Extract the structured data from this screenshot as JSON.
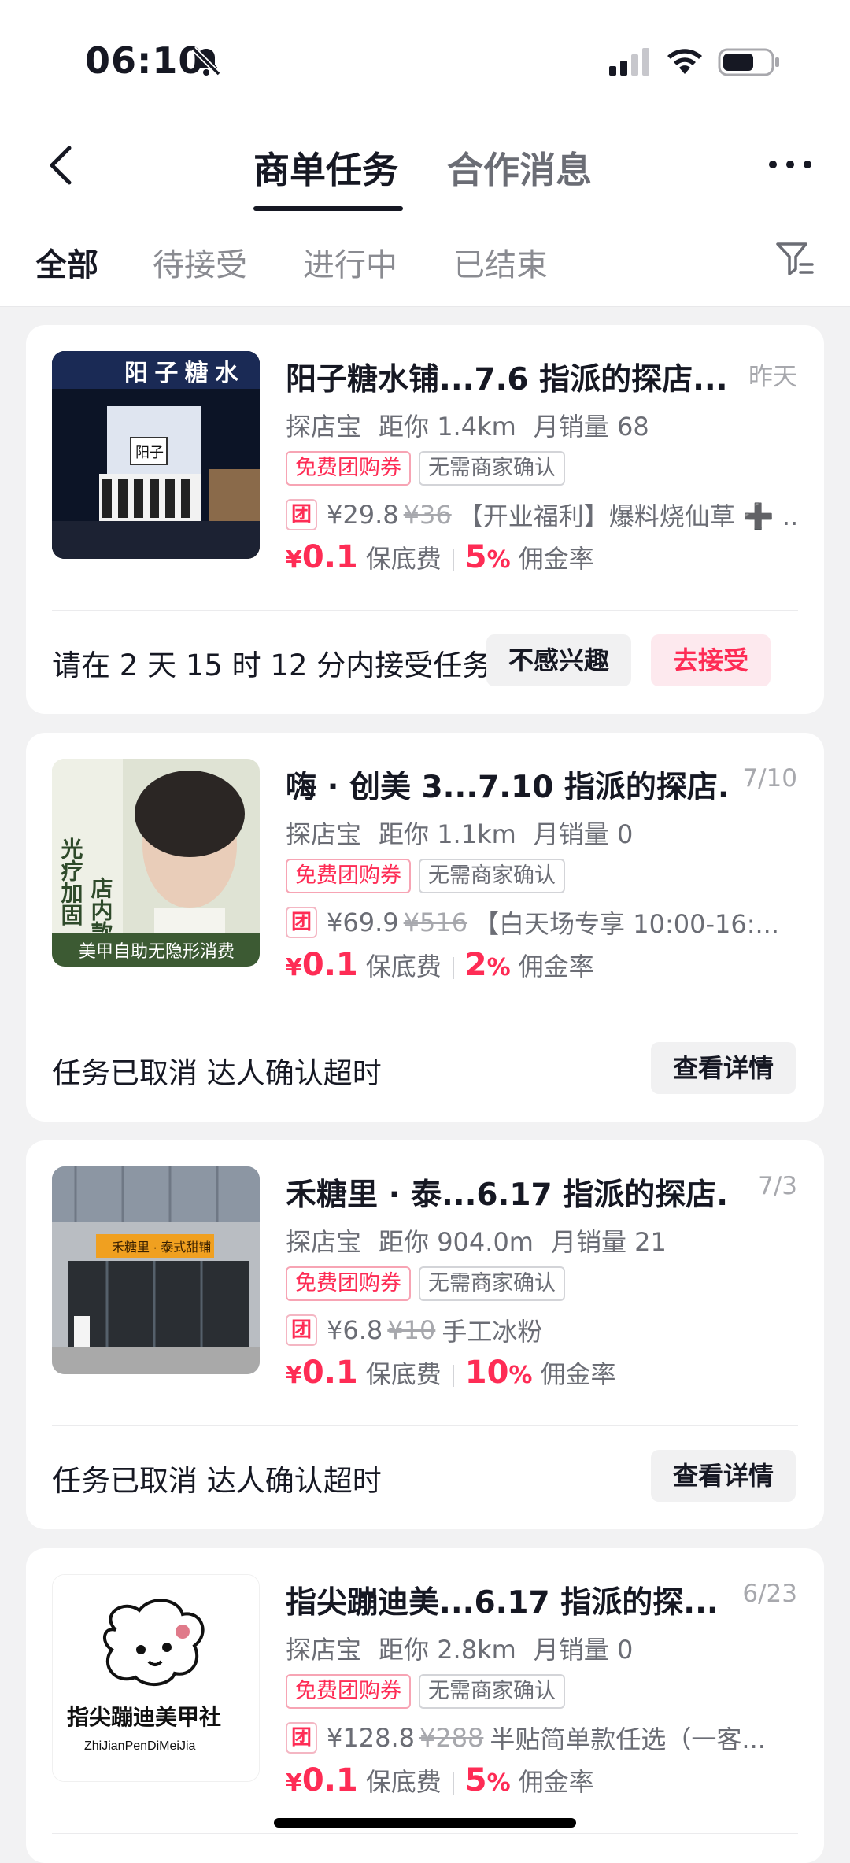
{
  "status": {
    "time": "06:10"
  },
  "nav": {
    "tab1": "商单任务",
    "tab2": "合作消息"
  },
  "subtabs": [
    "全部",
    "待接受",
    "进行中",
    "已结束"
  ],
  "common": {
    "tag_free": "免费团购券",
    "tag_no_confirm": "无需商家确认",
    "tuan": "团",
    "fee_label": "保底费",
    "rate_label": "佣金率",
    "yuan": "¥",
    "pct": "%"
  },
  "cards": [
    {
      "title": "阳子糖水铺...7.6 指派的探店...",
      "date": "昨天",
      "platform": "探店宝",
      "distance": "距你 1.4km",
      "sales": "月销量 68",
      "price": "¥29.8",
      "orig": "¥36",
      "deal": "【开业福利】爆料烧仙草 ➕ ...",
      "fee": "0.1",
      "rate": "5",
      "footer": "请在 2 天 15 时 12 分内接受任务",
      "btn1": "不感兴趣",
      "btn2": "去接受",
      "thumb_text": "阳 子 糖 水",
      "thumb_sign": "阳子"
    },
    {
      "title": "嗨 · 创美 3...7.10 指派的探店...",
      "date": "7/10",
      "platform": "探店宝",
      "distance": "距你 1.1km",
      "sales": "月销量 0",
      "price": "¥69.9",
      "orig": "¥516",
      "deal": "【白天场专享 10:00-16:...",
      "fee": "0.1",
      "rate": "2",
      "footer": "任务已取消 达人确认超时",
      "btn1": "查看详情",
      "thumb_v1": "店内款式不限",
      "thumb_v2": "光疗加固",
      "thumb_banner": "美甲自助无隐形消费"
    },
    {
      "title": "禾糖里 · 泰...6.17 指派的探店...",
      "date": "7/3",
      "platform": "探店宝",
      "distance": "距你 904.0m",
      "sales": "月销量 21",
      "price": "¥6.8",
      "orig": "¥10",
      "deal": "手工冰粉",
      "fee": "0.1",
      "rate": "10",
      "footer": "任务已取消 达人确认超时",
      "btn1": "查看详情",
      "thumb_sign": "禾糖里 · 泰式甜铺"
    },
    {
      "title": "指尖蹦迪美...6.17 指派的探...",
      "date": "6/23",
      "platform": "探店宝",
      "distance": "距你 2.8km",
      "sales": "月销量 0",
      "price": "¥128.8",
      "orig": "¥288",
      "deal": "半贴简单款任选（一客...",
      "fee": "0.1",
      "rate": "5",
      "thumb_name": "指尖蹦迪美甲社",
      "thumb_pinyin": "ZhiJianPenDiMeiJia"
    }
  ]
}
